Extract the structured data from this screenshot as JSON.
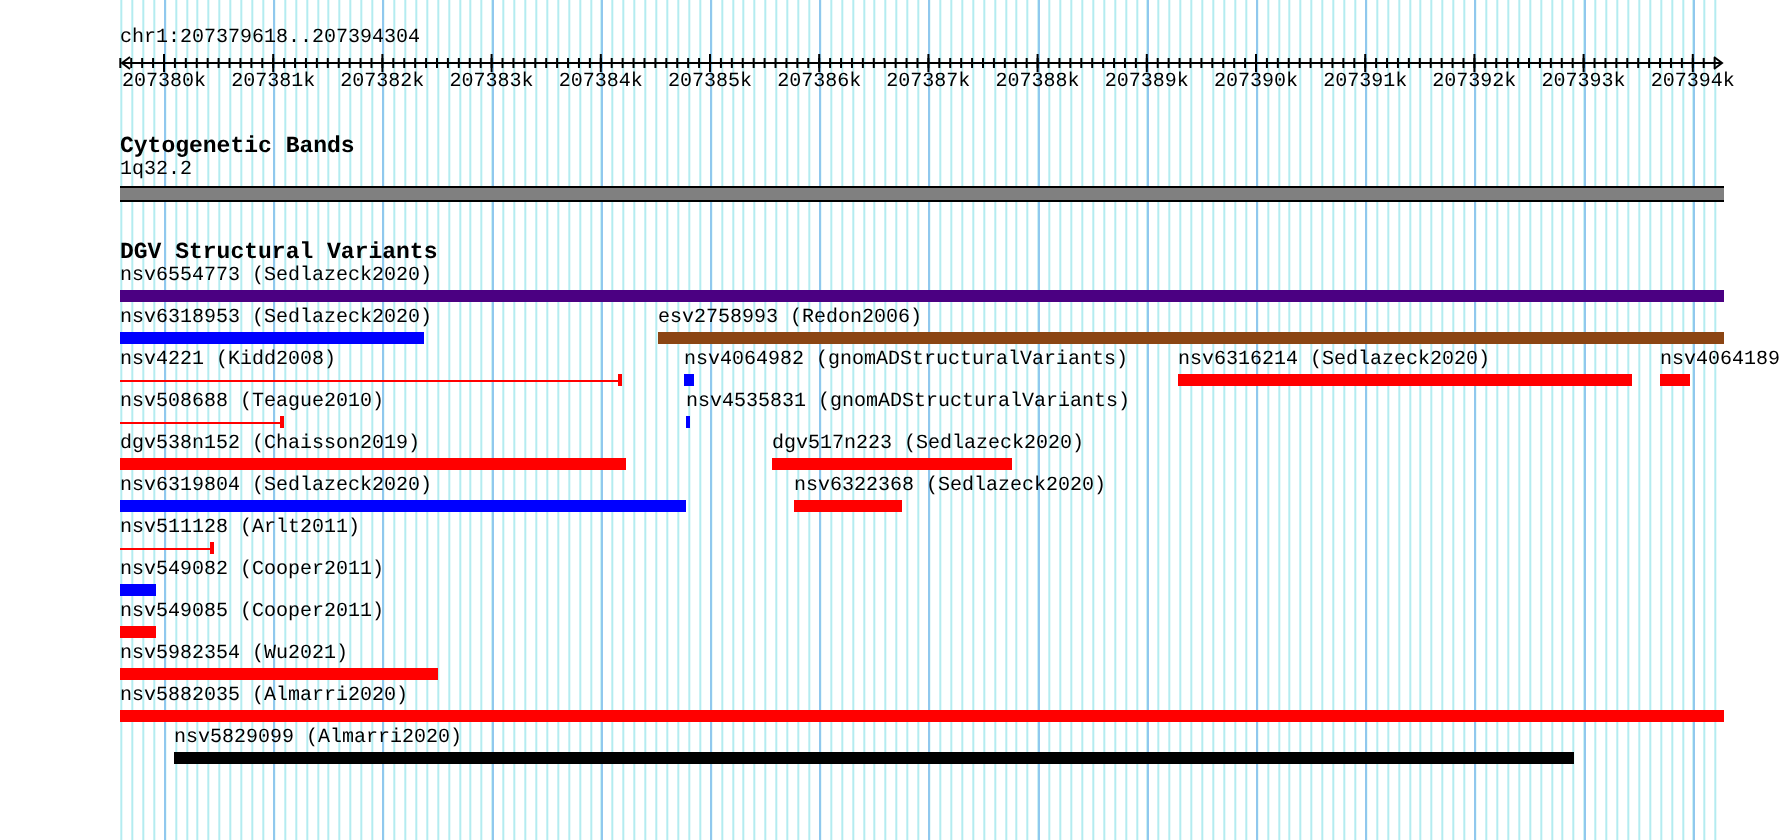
{
  "ruler": {
    "location": "chr1:207379618..207394304",
    "ticks": [
      "207380k",
      "207381k",
      "207382k",
      "207383k",
      "207384k",
      "207385k",
      "207386k",
      "207387k",
      "207388k",
      "207389k",
      "207390k",
      "207391k",
      "207392k",
      "207393k",
      "207394k"
    ]
  },
  "cytoband_track": {
    "title": "Cytogenetic Bands",
    "bands": [
      {
        "name": "1q32.2"
      }
    ]
  },
  "variant_track": {
    "title": "DGV Structural Variants",
    "rows": [
      [
        {
          "label": "nsv6554773 (Sedlazeck2020)",
          "kind": "bar",
          "color": "#4b0082"
        }
      ],
      [
        {
          "label": "nsv6318953 (Sedlazeck2020)",
          "kind": "bar",
          "color": "#0000ff"
        },
        {
          "label": "esv2758993 (Redon2006)",
          "kind": "bar",
          "color": "#8b4513"
        }
      ],
      [
        {
          "label": "nsv4221 (Kidd2008)",
          "kind": "line",
          "color": "#ff0000"
        },
        {
          "label": "nsv4064982 (gnomADStructuralVariants)",
          "kind": "bar",
          "color": "#0000ff"
        },
        {
          "label": "nsv6316214 (Sedlazeck2020)",
          "kind": "bar",
          "color": "#ff0000"
        },
        {
          "label": "nsv4064189",
          "kind": "bar",
          "color": "#ff0000"
        }
      ],
      [
        {
          "label": "nsv508688 (Teague2010)",
          "kind": "line",
          "color": "#ff0000"
        },
        {
          "label": "nsv4535831 (gnomADStructuralVariants)",
          "kind": "bar",
          "color": "#0000ff"
        }
      ],
      [
        {
          "label": "dgv538n152 (Chaisson2019)",
          "kind": "bar",
          "color": "#ff0000"
        },
        {
          "label": "dgv517n223 (Sedlazeck2020)",
          "kind": "bar",
          "color": "#ff0000"
        }
      ],
      [
        {
          "label": "nsv6319804 (Sedlazeck2020)",
          "kind": "bar",
          "color": "#0000ff"
        },
        {
          "label": "nsv6322368 (Sedlazeck2020)",
          "kind": "bar",
          "color": "#ff0000"
        }
      ],
      [
        {
          "label": "nsv511128 (Arlt2011)",
          "kind": "line",
          "color": "#ff0000"
        }
      ],
      [
        {
          "label": "nsv549082 (Cooper2011)",
          "kind": "bar",
          "color": "#0000ff"
        }
      ],
      [
        {
          "label": "nsv549085 (Cooper2011)",
          "kind": "bar",
          "color": "#ff0000"
        }
      ],
      [
        {
          "label": "nsv5982354 (Wu2021)",
          "kind": "bar",
          "color": "#ff0000"
        }
      ],
      [
        {
          "label": "nsv5882035 (Almarri2020)",
          "kind": "bar",
          "color": "#ff0000"
        }
      ],
      [
        {
          "label": "nsv5829099 (Almarri2020)",
          "kind": "bar",
          "color": "#000000"
        }
      ]
    ]
  }
}
